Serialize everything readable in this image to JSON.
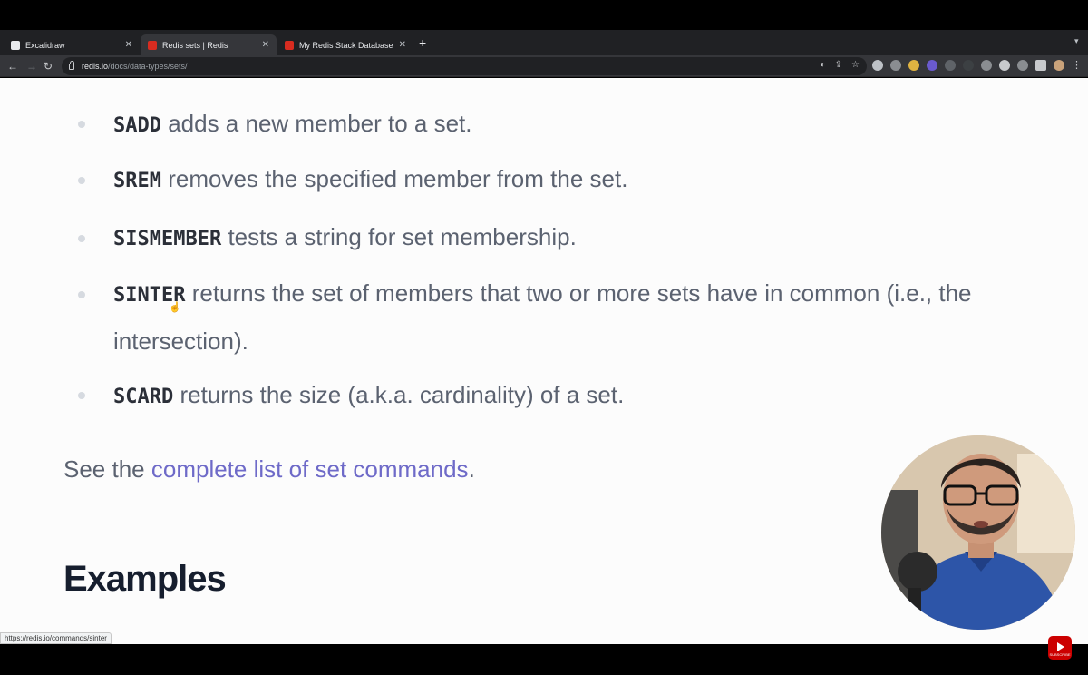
{
  "browser": {
    "tabs": [
      {
        "title": "Excalidraw",
        "favicon_color": "#e8eaed",
        "active": false
      },
      {
        "title": "Redis sets | Redis",
        "favicon_color": "#d82c20",
        "active": true
      },
      {
        "title": "My Redis Stack Database - Bro",
        "favicon_color": "#d82c20",
        "active": false
      }
    ],
    "tab_close": "✕",
    "new_tab": "+",
    "url_host": "redis.io",
    "url_path": "/docs/data-types/sets/",
    "status_url": "https://redis.io/commands/sinter"
  },
  "content": {
    "items": [
      {
        "command": "SADD",
        "text": " adds a new member to a set."
      },
      {
        "command": "SREM",
        "text": " removes the specified member from the set."
      },
      {
        "command": "SISMEMBER",
        "text": " tests a string for set membership."
      },
      {
        "command": "SINTER",
        "text": " returns the set of members that two or more sets have in common (i.e., the intersection)."
      },
      {
        "command": "SCARD",
        "text": " returns the size (a.k.a. cardinality) of a set."
      }
    ],
    "see_prefix": "See the ",
    "see_link": "complete list of set commands",
    "see_suffix": ".",
    "heading": "Examples"
  },
  "overlay": {
    "subscribe_label": "SUBSCRIBE"
  },
  "colors": {
    "link": "#6e6ac8",
    "text": "#5b6270",
    "heading": "#161e2e",
    "page_bg": "#fcfcfc"
  }
}
